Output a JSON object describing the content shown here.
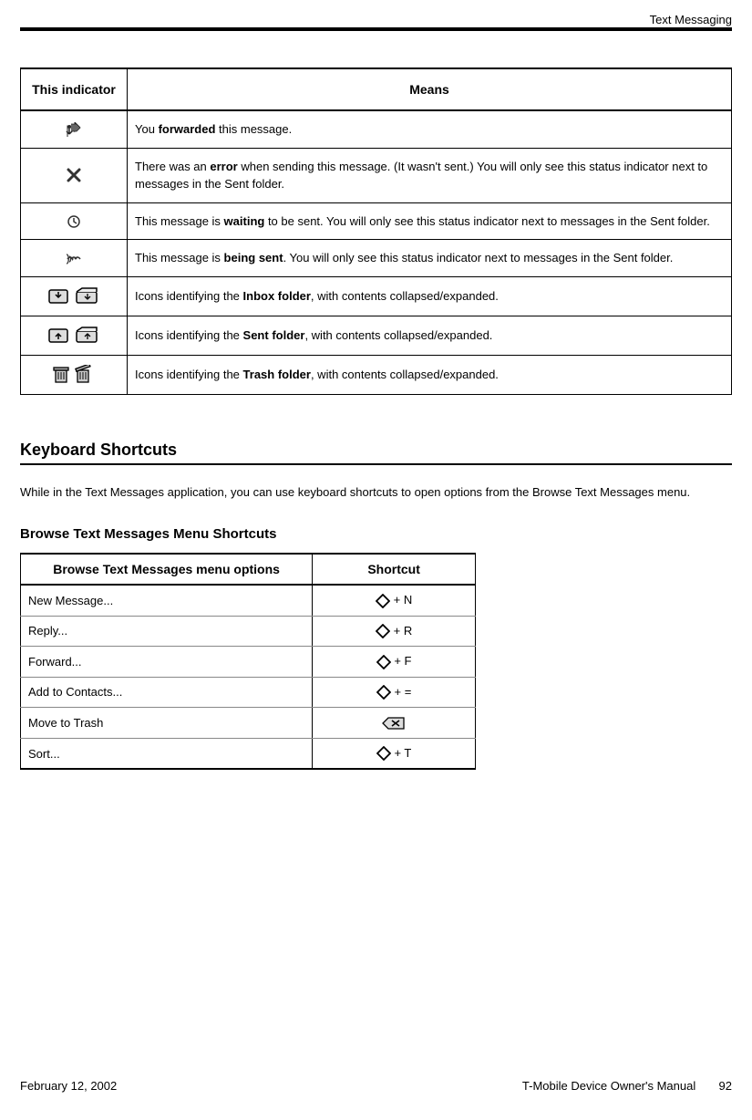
{
  "header": {
    "section_label": "Text Messaging"
  },
  "indicator_table": {
    "col1": "This indicator",
    "col2": "Means",
    "rows": [
      {
        "icon": "forwarded-icon",
        "text_parts": [
          "You ",
          "forwarded",
          " this message."
        ]
      },
      {
        "icon": "error-icon",
        "text_parts": [
          "There was an ",
          "error",
          " when sending this message. (It wasn't sent.) You will only see this status indicator next to messages in the Sent folder."
        ]
      },
      {
        "icon": "waiting-icon",
        "text_parts": [
          "This message is ",
          "waiting",
          " to be sent. You will only see this status indicator next to messages in the Sent folder."
        ]
      },
      {
        "icon": "sending-icon",
        "text_parts": [
          "This message is ",
          "being sent",
          ". You will only see this status indicator next to messages in the Sent folder."
        ]
      },
      {
        "icon": "inbox-folder-icons",
        "text_parts": [
          "Icons identifying the ",
          "Inbox folder",
          ", with contents collapsed/expanded."
        ]
      },
      {
        "icon": "sent-folder-icons",
        "text_parts": [
          "Icons identifying the ",
          "Sent folder",
          ", with contents collapsed/expanded."
        ]
      },
      {
        "icon": "trash-folder-icons",
        "text_parts": [
          "Icons identifying the ",
          "Trash folder",
          ", with contents collapsed/expanded."
        ]
      }
    ]
  },
  "shortcuts": {
    "heading": "Keyboard Shortcuts",
    "intro": "While in the Text Messages application, you can use keyboard shortcuts to open options from the Browse Text Messages menu.",
    "sub_heading": "Browse Text Messages Menu Shortcuts",
    "col1": "Browse Text Messages menu options",
    "col2": "Shortcut",
    "rows": [
      {
        "option": "New Message...",
        "key": " + N",
        "icon": "diamond-icon"
      },
      {
        "option": "Reply...",
        "key": " + R",
        "icon": "diamond-icon"
      },
      {
        "option": "Forward...",
        "key": " + F",
        "icon": "diamond-icon"
      },
      {
        "option": "Add to Contacts...",
        "key": " + =",
        "icon": "diamond-icon"
      },
      {
        "option": "Move to Trash",
        "key": "",
        "icon": "delete-key-icon"
      },
      {
        "option": "Sort...",
        "key": " + T",
        "icon": "diamond-icon"
      }
    ]
  },
  "footer": {
    "date": "February 12, 2002",
    "title": "T-Mobile Device Owner's Manual",
    "page": "92"
  }
}
